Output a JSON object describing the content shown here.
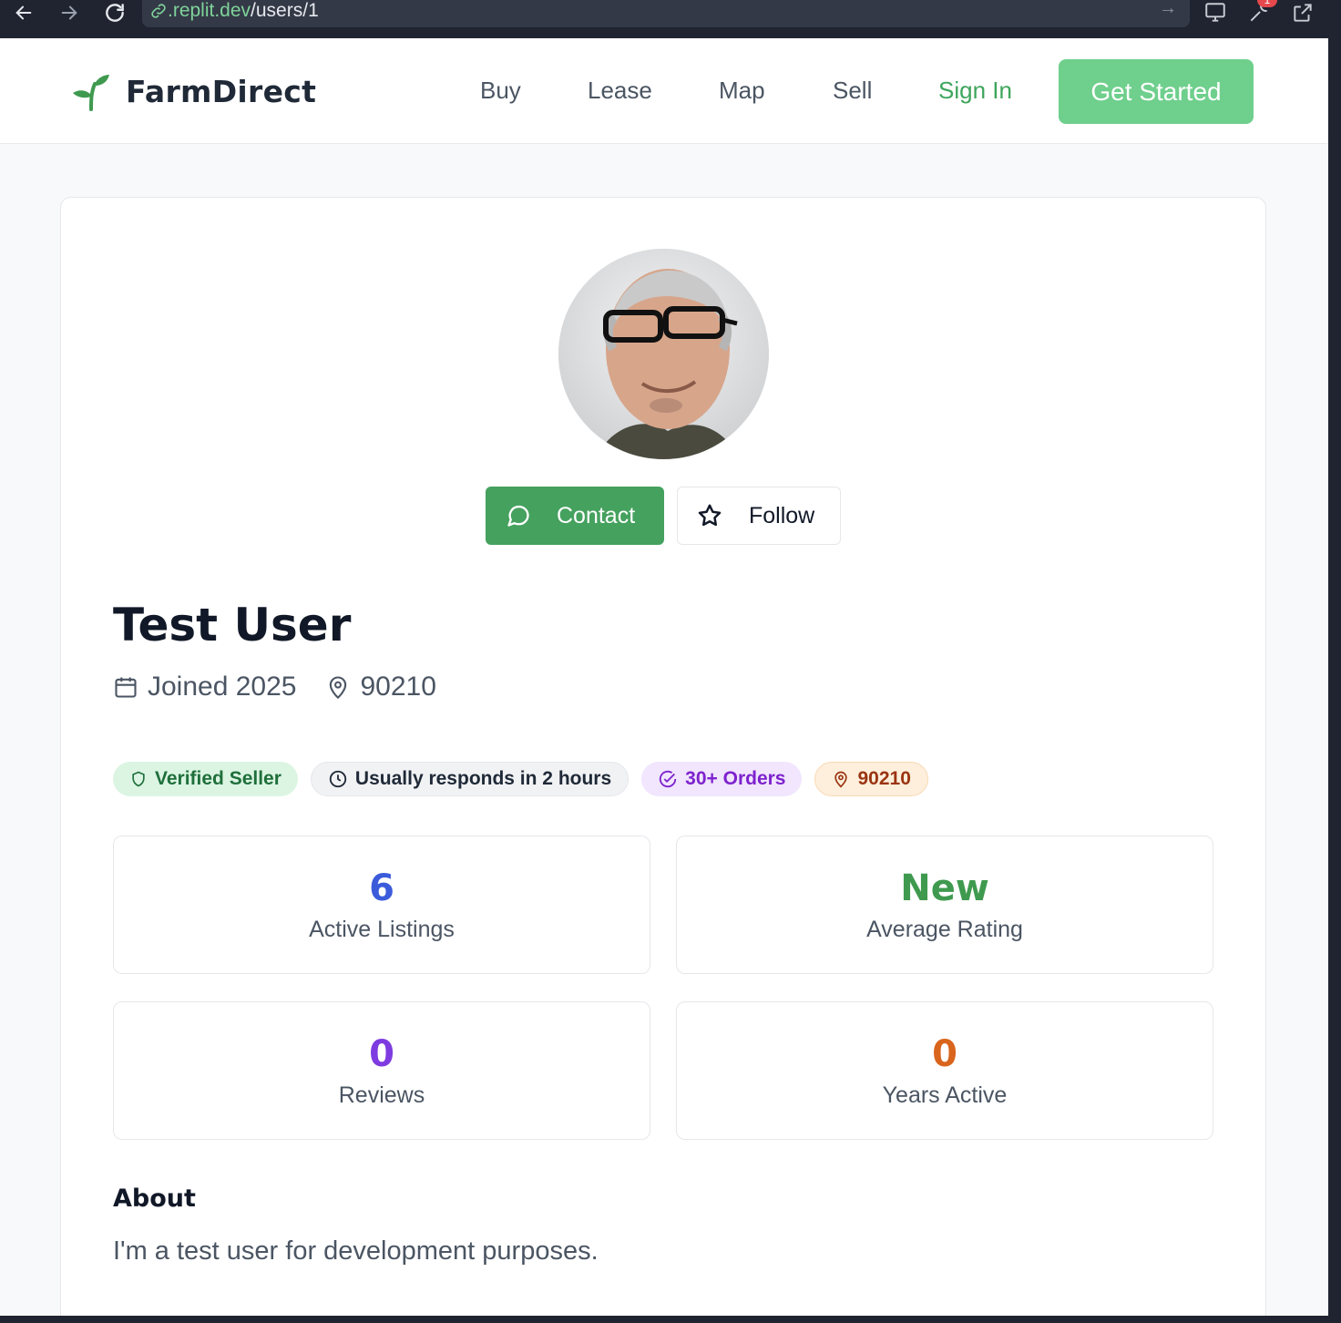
{
  "browser": {
    "url_host": ".replit.dev",
    "url_path": "/users/1",
    "notification_count": "1"
  },
  "nav": {
    "brand": "FarmDirect",
    "links": [
      "Buy",
      "Lease",
      "Map",
      "Sell"
    ],
    "sign_in": "Sign In",
    "cta": "Get Started"
  },
  "profile": {
    "contact_label": "Contact",
    "follow_label": "Follow",
    "name": "Test User",
    "joined": "Joined 2025",
    "location": "90210",
    "badges": {
      "verified": "Verified Seller",
      "responds": "Usually responds in 2 hours",
      "orders": "30+ Orders",
      "zip": "90210"
    },
    "stats": [
      {
        "value": "6",
        "label": "Active Listings",
        "color": "#3b5bdb"
      },
      {
        "value": "New",
        "label": "Average Rating",
        "color": "#3f9a4f"
      },
      {
        "value": "0",
        "label": "Reviews",
        "color": "#7e3be0"
      },
      {
        "value": "0",
        "label": "Years Active",
        "color": "#d9641c"
      }
    ],
    "about_heading": "About",
    "about_text": "I'm a test user for development purposes."
  },
  "colors": {
    "primary": "#45a15e",
    "cta": "#6fcf8c",
    "text": "#111827"
  }
}
